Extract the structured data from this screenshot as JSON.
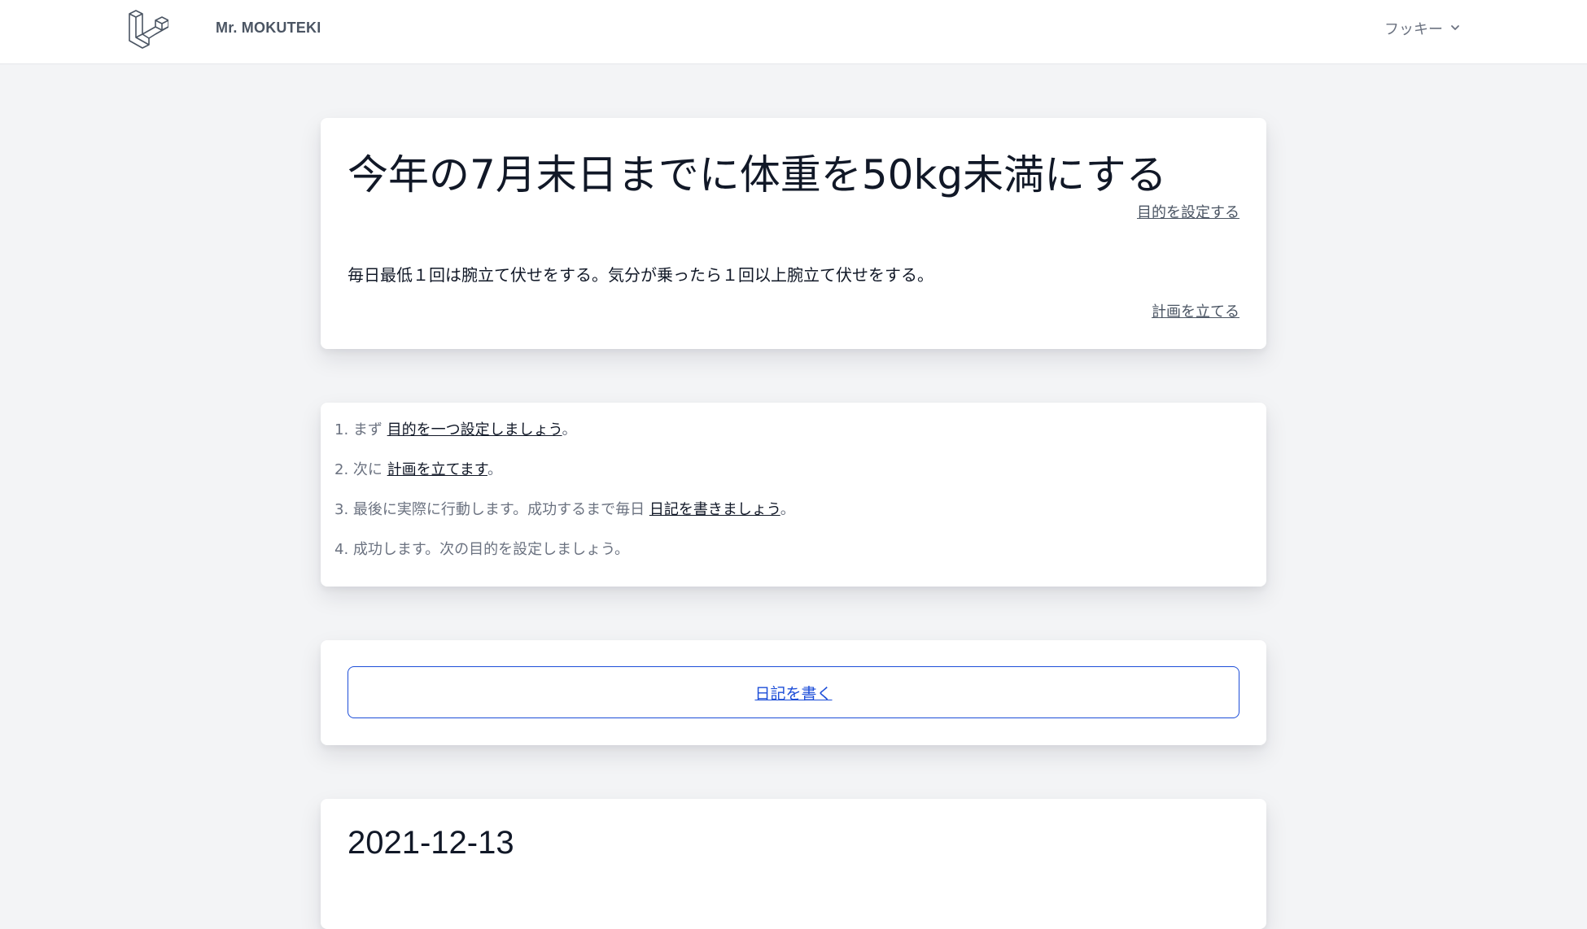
{
  "header": {
    "logo_icon": "laravel-logo-icon",
    "brand": "Mr. MOKUTEKI",
    "user_name": "フッキー",
    "user_menu_icon": "chevron-down-icon"
  },
  "goal": {
    "title": "今年の7月末日までに体重を50kg未満にする",
    "set_goal_link": "目的を設定する",
    "plan_text": "毎日最低１回は腕立て伏せをする。気分が乗ったら１回以上腕立て伏せをする。",
    "make_plan_link": "計画を立てる"
  },
  "steps": [
    {
      "prefix": "1. まず ",
      "link": "目的を一つ設定しましょう",
      "suffix": "。"
    },
    {
      "prefix": "2. 次に ",
      "link": "計画を立てます",
      "suffix": "。"
    },
    {
      "prefix": "3. 最後に実際に行動します。成功するまで毎日 ",
      "link": "日記を書きましょう",
      "suffix": "。"
    },
    {
      "prefix": "4. 成功します。次の目的を設定しましょう。",
      "link": "",
      "suffix": ""
    }
  ],
  "diary": {
    "write_button": "日記を書く"
  },
  "entries": [
    {
      "date": "2021-12-13"
    }
  ],
  "colors": {
    "page_bg": "#f3f4f6",
    "card_bg": "#ffffff",
    "accent": "#1d4ed8",
    "muted_text": "#6b7280"
  }
}
